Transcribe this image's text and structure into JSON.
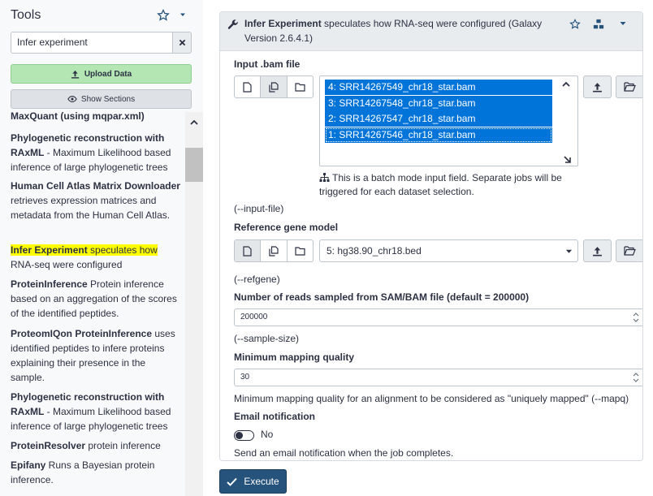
{
  "tool_panel": {
    "title": "Tools",
    "search": {
      "value": "Infer experiment"
    },
    "upload_label": "Upload Data",
    "sections_label": "Show Sections",
    "items": [
      {
        "name": "MaxQuant (using mqpar.xml)",
        "desc": ""
      },
      {
        "name": "Phylogenetic reconstruction with RAxML",
        "desc": " - Maximum Likelihood based inference of large phylogenetic trees"
      },
      {
        "name": "Human Cell Atlas Matrix Downloader",
        "desc": " retrieves expression matrices and metadata from the Human Cell Atlas."
      },
      {
        "name": "Infer Experiment",
        "desc_hl": " speculates how",
        "desc": " RNA-seq were configured"
      },
      {
        "name": "ProteinInference",
        "desc": " Protein inference based on an aggregation of the scores of the identified peptides."
      },
      {
        "name": "ProteomIQon ProteinInference",
        "desc": " uses identified peptides to infere proteins explaining their presence in the sample."
      },
      {
        "name": "Phylogenetic reconstruction with RAxML",
        "desc": " - Maximum Likelihood based inference of large phylogenetic trees"
      },
      {
        "name": "ProteinResolver",
        "desc": " protein inference"
      },
      {
        "name": "Epifany",
        "desc": " Runs a Bayesian protein inference."
      }
    ]
  },
  "tool_form": {
    "tool_name": "Infer Experiment",
    "tool_desc": " speculates how RNA-seq were configured (Galaxy Version 2.6.4.1)",
    "input_bam": {
      "label": "Input .bam file",
      "options": [
        "4: SRR14267549_chr18_star.bam",
        "3: SRR14267548_chr18_star.bam",
        "2: SRR14267547_chr18_star.bam",
        "1: SRR14267546_chr18_star.bam"
      ],
      "batch_note": "This is a batch mode input field. Separate jobs will be triggered for each dataset selection.",
      "arg": "(--input-file)"
    },
    "refgene": {
      "label": "Reference gene model",
      "selected": "5: hg38.90_chr18.bed",
      "arg": "(--refgene)"
    },
    "sample_size": {
      "label": "Number of reads sampled from SAM/BAM file (default = 200000)",
      "value": "200000",
      "arg": "(--sample-size)"
    },
    "mapq": {
      "label": "Minimum mapping quality",
      "value": "30",
      "help": "Minimum mapping quality for an alignment to be considered as \"uniquely mapped\" (--mapq)"
    },
    "email": {
      "label": "Email notification",
      "toggle_value": "No",
      "help": "Send an email notification when the job completes."
    },
    "execute_label": "Execute"
  }
}
